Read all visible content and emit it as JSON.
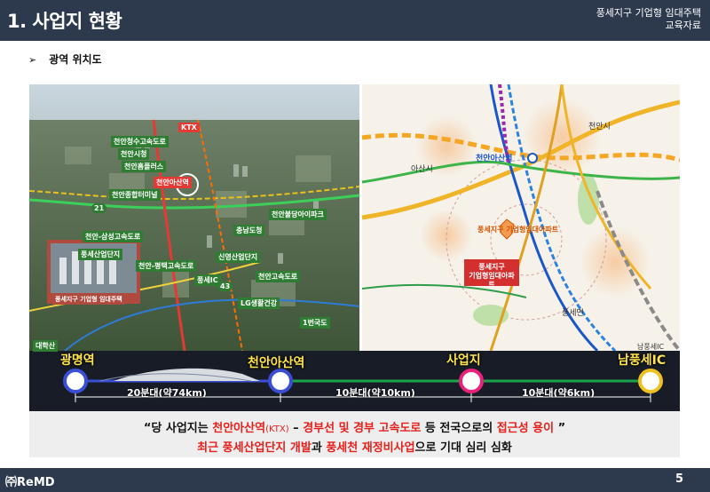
{
  "header": {
    "title": "1. 사업지 현황",
    "right_line1": "풍세지구 기업형 임대주택",
    "right_line2": "교육자료"
  },
  "section": {
    "arrow": "➢",
    "label": "광역 위치도"
  },
  "aerial": {
    "tags": [
      "KTX",
      "천안청수고속도로",
      "천안시청",
      "천안홈플러스",
      "천안아산역",
      "천안종합터미널",
      "21",
      "천안불당아이파크",
      "충남도청",
      "천안-삼성고속도로",
      "풍세산업단지",
      "천안-평택고속도로",
      "천안고속도로",
      "신영산업단지",
      "풍세지구 기업형 임대주택",
      "풍세IC",
      "43",
      "LG생활건강"
    ],
    "place_labels": [
      "대학산",
      "1번국도"
    ]
  },
  "map": {
    "labels": [
      "아산시",
      "천안아산역",
      "풍세지구 기업형임대아파트",
      "천안시",
      "풍세면",
      "남풍세IC"
    ],
    "callout": "풍세지구\n기업형임대아파트"
  },
  "route": {
    "stops": [
      "광명역",
      "천안아산역",
      "사업지",
      "남풍세IC"
    ],
    "durations": [
      "20분대(약74km)",
      "10분대(약10km)",
      "10분대(약6km)"
    ],
    "stop_colors": [
      "#3a4fd6",
      "#3a4fd6",
      "#e8217a",
      "#f0c020"
    ]
  },
  "quote": {
    "l1_a": "“당 사업지는 ",
    "l1_b": "천안아산역",
    "l1_c": "(KTX)",
    "l1_d": " – ",
    "l1_e": "경부선  및 경부 고속도로",
    "l1_f": " 등 전국으로의 ",
    "l1_g": "접근성 용이",
    "l1_h": " ”",
    "l2_a": "최근 풍세산업단지 개발",
    "l2_b": "과 ",
    "l2_c": "풍세천 재정비사업",
    "l2_d": "으로 기대 심리 심화"
  },
  "footer": {
    "logo": "㈜ReMD",
    "page": "5"
  }
}
